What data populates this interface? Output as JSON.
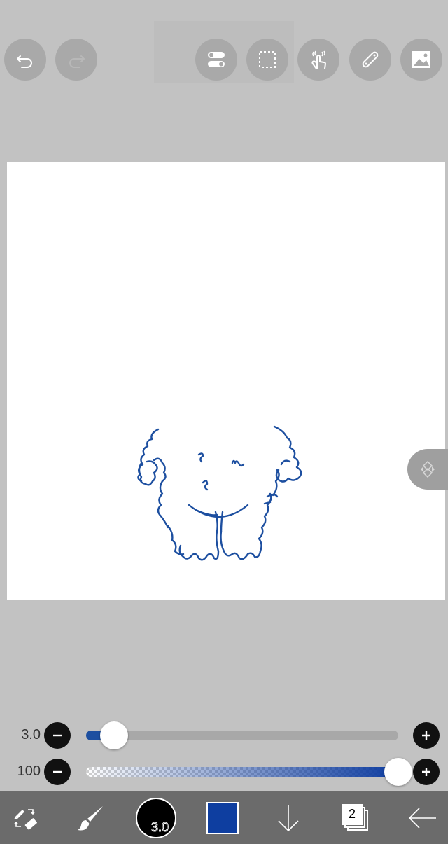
{
  "toolbar": {
    "undo_icon": "undo-icon",
    "redo_icon": "redo-icon",
    "toggle_icon": "toggles-icon",
    "selection_icon": "selection-icon",
    "hand_icon": "hand-tap-icon",
    "ruler_icon": "ruler-icon",
    "image_icon": "image-icon"
  },
  "brush_size": {
    "label": "3.0",
    "level": 0.09
  },
  "opacity": {
    "label": "100",
    "level": 1.0
  },
  "bottom": {
    "brush_size_label": "3.0",
    "layer_count": "2",
    "color": "#0e3ea0"
  },
  "colors": {
    "background": "#c2c2c2",
    "stroke": "#1d4fa0",
    "bottom_bar": "#6b6b6b"
  }
}
